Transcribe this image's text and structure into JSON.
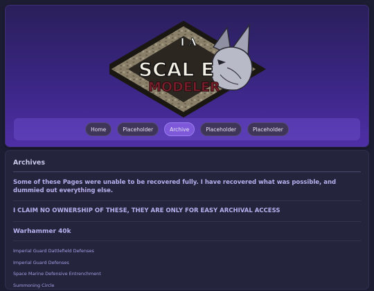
{
  "header": {
    "logo": {
      "line1": "SCAL E",
      "line2": "MODELER",
      "accent": "I A"
    }
  },
  "nav": {
    "items": [
      {
        "label": "Home",
        "active": false
      },
      {
        "label": "Placeholder",
        "active": false
      },
      {
        "label": "Archive",
        "active": true
      },
      {
        "label": "Placeholder",
        "active": false
      },
      {
        "label": "Placeholder",
        "active": false
      }
    ]
  },
  "content": {
    "title": "Archives",
    "note": "Some of these Pages were unable to be recovered fully. I have recovered what was possible, and dummied out everything else.",
    "claim": "I CLAIM NO OWNERSHIP OF THESE, THEY ARE ONLY FOR EASY ARCHIVAL ACCESS",
    "section": {
      "title": "Warhammer 40k",
      "links": [
        "Imperial Guard Dattlefield Defenses",
        "Imperial Guard Defenses",
        "Space Marine Defensive Entrenchment",
        "Summoning Circle"
      ]
    }
  },
  "colors": {
    "background": "#1c1d33",
    "header_top": "#2a1f5a",
    "header_bottom": "#4f2fa6",
    "nav_active": "#7d58d8",
    "link": "#a49fe6"
  }
}
